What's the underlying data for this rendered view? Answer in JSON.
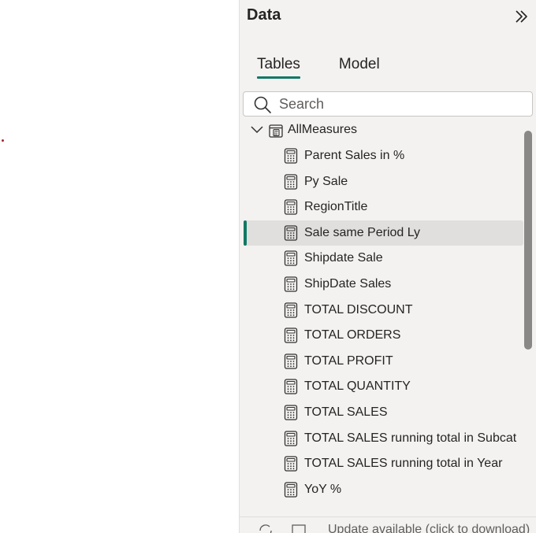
{
  "pane": {
    "title": "Data",
    "collapse_icon": "double-chevron-right-icon"
  },
  "tabs": [
    {
      "label": "Tables",
      "active": true
    },
    {
      "label": "Model",
      "active": false
    }
  ],
  "search": {
    "placeholder": "Search",
    "icon": "search-icon"
  },
  "tree": {
    "group": {
      "label": "AllMeasures",
      "expanded": true,
      "icon": "measure-table-icon"
    },
    "fields": [
      {
        "label": "Parent Sales in %",
        "icon": "calculator-icon",
        "selected": false
      },
      {
        "label": "Py Sale",
        "icon": "calculator-icon",
        "selected": false
      },
      {
        "label": "RegionTitle",
        "icon": "calculator-icon",
        "selected": false
      },
      {
        "label": "Sale same Period Ly",
        "icon": "calculator-icon",
        "selected": true
      },
      {
        "label": "Shipdate Sale",
        "icon": "calculator-icon",
        "selected": false
      },
      {
        "label": "ShipDate Sales",
        "icon": "calculator-icon",
        "selected": false
      },
      {
        "label": "TOTAL DISCOUNT",
        "icon": "calculator-icon",
        "selected": false
      },
      {
        "label": "TOTAL ORDERS",
        "icon": "calculator-icon",
        "selected": false
      },
      {
        "label": "TOTAL PROFIT",
        "icon": "calculator-icon",
        "selected": false
      },
      {
        "label": "TOTAL QUANTITY",
        "icon": "calculator-icon",
        "selected": false
      },
      {
        "label": "TOTAL SALES",
        "icon": "calculator-icon",
        "selected": false
      },
      {
        "label": "TOTAL SALES running total in Subcat",
        "icon": "calculator-icon",
        "selected": false
      },
      {
        "label": "TOTAL SALES running total in Year",
        "icon": "calculator-icon",
        "selected": false
      },
      {
        "label": "YoY %",
        "icon": "calculator-icon",
        "selected": false
      }
    ]
  },
  "status": {
    "text": "Update available (click to download)",
    "icons": [
      "refresh-icon",
      "fit-to-page-icon"
    ]
  },
  "colors": {
    "accent": "#117865",
    "pane_bg": "#f3f2f1",
    "selected_bg": "#e1dfdd",
    "text": "#252423"
  }
}
